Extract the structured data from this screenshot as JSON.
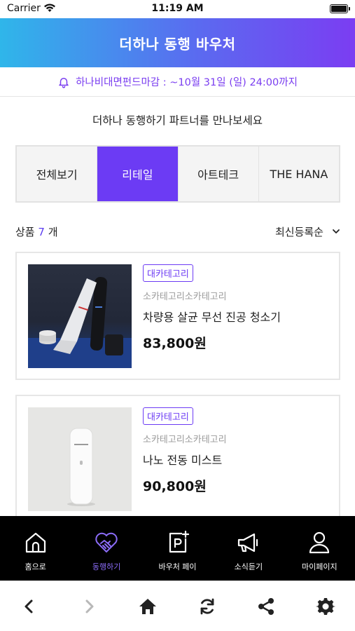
{
  "status": {
    "carrier": "Carrier",
    "time": "11:19 AM"
  },
  "header": {
    "title": "더하나 동행 바우처"
  },
  "notice": {
    "text": "하나비대면펀드마감 : ~10월 31일 (일) 24:00까지",
    "color": "#7a3df0"
  },
  "subtitle": "더하나 동행하기 파트너를 만나보세요",
  "tabs": [
    {
      "label": "전체보기",
      "active": false
    },
    {
      "label": "리테일",
      "active": true
    },
    {
      "label": "아트테크",
      "active": false
    },
    {
      "label": "THE HANA",
      "active": false
    }
  ],
  "product_count": {
    "prefix": "상품 ",
    "number": "7",
    "suffix": " 개"
  },
  "sort": {
    "selected": "최신등록순"
  },
  "products": [
    {
      "category": "대카테고리",
      "subcategory": "소카테고리소카테고리",
      "name": "차량용 살균 무선 진공 청소기",
      "price": "83,800원",
      "image": "handheld-vacuum-image"
    },
    {
      "category": "대카테고리",
      "subcategory": "소카테고리소카테고리",
      "name": "나노 전동 미스트",
      "price": "90,800원",
      "image": "mist-device-image"
    }
  ],
  "bottom_nav": [
    {
      "label": "홈으로",
      "icon": "home-icon",
      "active": false
    },
    {
      "label": "동행하기",
      "icon": "heart-handshake-icon",
      "active": true
    },
    {
      "label": "바우처 페이",
      "icon": "voucher-pay-icon",
      "active": false
    },
    {
      "label": "소식듣기",
      "icon": "megaphone-icon",
      "active": false
    },
    {
      "label": "마이페이지",
      "icon": "user-icon",
      "active": false
    }
  ],
  "browser_bar": [
    "back-icon",
    "forward-icon",
    "home-icon",
    "refresh-icon",
    "share-icon",
    "settings-icon"
  ],
  "colors": {
    "accent": "#6c3bf4",
    "header_start": "#2fb6ea",
    "header_end": "#7b3df2"
  }
}
